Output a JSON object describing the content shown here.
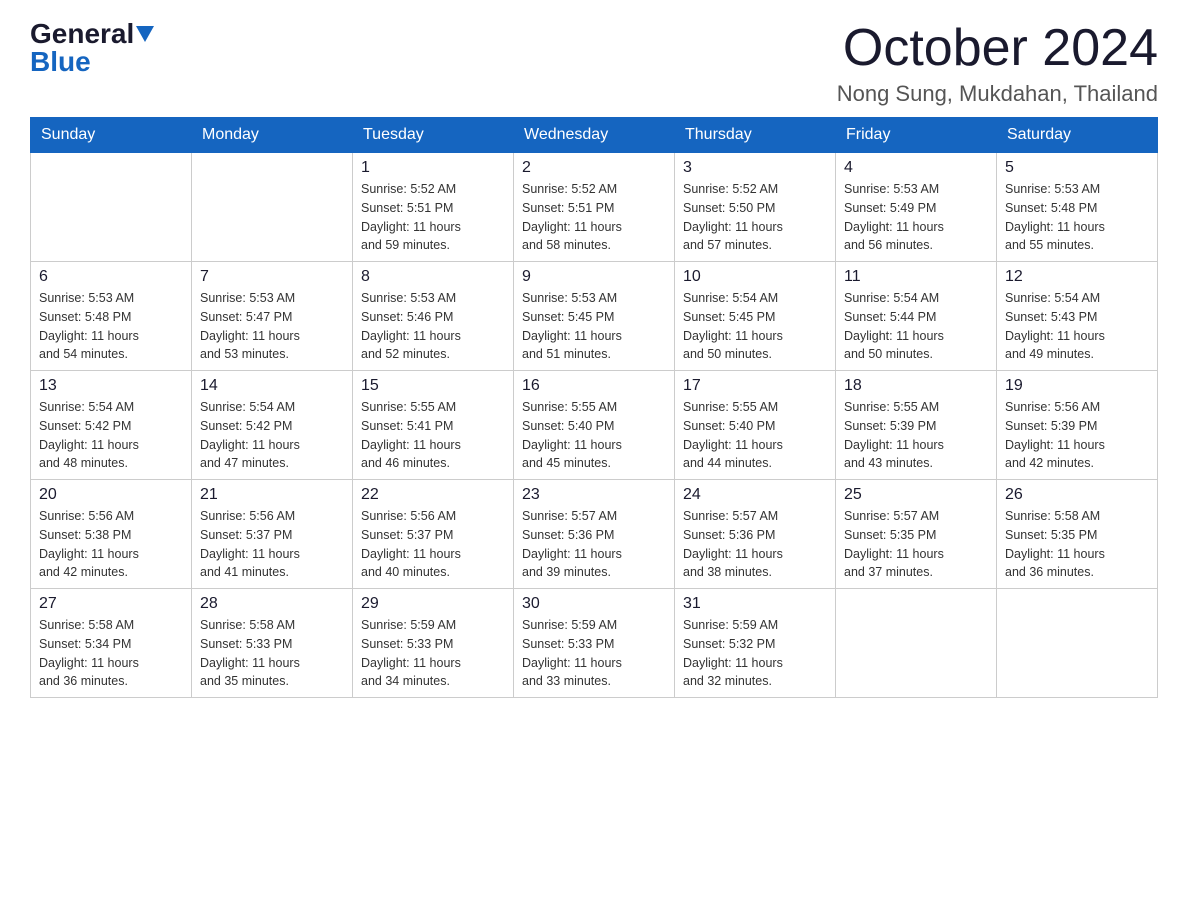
{
  "logo": {
    "general_text": "General",
    "blue_text": "Blue"
  },
  "title": {
    "month_year": "October 2024",
    "location": "Nong Sung, Mukdahan, Thailand"
  },
  "headers": [
    "Sunday",
    "Monday",
    "Tuesday",
    "Wednesday",
    "Thursday",
    "Friday",
    "Saturday"
  ],
  "weeks": [
    [
      {
        "day": "",
        "info": ""
      },
      {
        "day": "",
        "info": ""
      },
      {
        "day": "1",
        "sunrise": "5:52 AM",
        "sunset": "5:51 PM",
        "daylight": "11 hours and 59 minutes."
      },
      {
        "day": "2",
        "sunrise": "5:52 AM",
        "sunset": "5:51 PM",
        "daylight": "11 hours and 58 minutes."
      },
      {
        "day": "3",
        "sunrise": "5:52 AM",
        "sunset": "5:50 PM",
        "daylight": "11 hours and 57 minutes."
      },
      {
        "day": "4",
        "sunrise": "5:53 AM",
        "sunset": "5:49 PM",
        "daylight": "11 hours and 56 minutes."
      },
      {
        "day": "5",
        "sunrise": "5:53 AM",
        "sunset": "5:48 PM",
        "daylight": "11 hours and 55 minutes."
      }
    ],
    [
      {
        "day": "6",
        "sunrise": "5:53 AM",
        "sunset": "5:48 PM",
        "daylight": "11 hours and 54 minutes."
      },
      {
        "day": "7",
        "sunrise": "5:53 AM",
        "sunset": "5:47 PM",
        "daylight": "11 hours and 53 minutes."
      },
      {
        "day": "8",
        "sunrise": "5:53 AM",
        "sunset": "5:46 PM",
        "daylight": "11 hours and 52 minutes."
      },
      {
        "day": "9",
        "sunrise": "5:53 AM",
        "sunset": "5:45 PM",
        "daylight": "11 hours and 51 minutes."
      },
      {
        "day": "10",
        "sunrise": "5:54 AM",
        "sunset": "5:45 PM",
        "daylight": "11 hours and 50 minutes."
      },
      {
        "day": "11",
        "sunrise": "5:54 AM",
        "sunset": "5:44 PM",
        "daylight": "11 hours and 50 minutes."
      },
      {
        "day": "12",
        "sunrise": "5:54 AM",
        "sunset": "5:43 PM",
        "daylight": "11 hours and 49 minutes."
      }
    ],
    [
      {
        "day": "13",
        "sunrise": "5:54 AM",
        "sunset": "5:42 PM",
        "daylight": "11 hours and 48 minutes."
      },
      {
        "day": "14",
        "sunrise": "5:54 AM",
        "sunset": "5:42 PM",
        "daylight": "11 hours and 47 minutes."
      },
      {
        "day": "15",
        "sunrise": "5:55 AM",
        "sunset": "5:41 PM",
        "daylight": "11 hours and 46 minutes."
      },
      {
        "day": "16",
        "sunrise": "5:55 AM",
        "sunset": "5:40 PM",
        "daylight": "11 hours and 45 minutes."
      },
      {
        "day": "17",
        "sunrise": "5:55 AM",
        "sunset": "5:40 PM",
        "daylight": "11 hours and 44 minutes."
      },
      {
        "day": "18",
        "sunrise": "5:55 AM",
        "sunset": "5:39 PM",
        "daylight": "11 hours and 43 minutes."
      },
      {
        "day": "19",
        "sunrise": "5:56 AM",
        "sunset": "5:39 PM",
        "daylight": "11 hours and 42 minutes."
      }
    ],
    [
      {
        "day": "20",
        "sunrise": "5:56 AM",
        "sunset": "5:38 PM",
        "daylight": "11 hours and 42 minutes."
      },
      {
        "day": "21",
        "sunrise": "5:56 AM",
        "sunset": "5:37 PM",
        "daylight": "11 hours and 41 minutes."
      },
      {
        "day": "22",
        "sunrise": "5:56 AM",
        "sunset": "5:37 PM",
        "daylight": "11 hours and 40 minutes."
      },
      {
        "day": "23",
        "sunrise": "5:57 AM",
        "sunset": "5:36 PM",
        "daylight": "11 hours and 39 minutes."
      },
      {
        "day": "24",
        "sunrise": "5:57 AM",
        "sunset": "5:36 PM",
        "daylight": "11 hours and 38 minutes."
      },
      {
        "day": "25",
        "sunrise": "5:57 AM",
        "sunset": "5:35 PM",
        "daylight": "11 hours and 37 minutes."
      },
      {
        "day": "26",
        "sunrise": "5:58 AM",
        "sunset": "5:35 PM",
        "daylight": "11 hours and 36 minutes."
      }
    ],
    [
      {
        "day": "27",
        "sunrise": "5:58 AM",
        "sunset": "5:34 PM",
        "daylight": "11 hours and 36 minutes."
      },
      {
        "day": "28",
        "sunrise": "5:58 AM",
        "sunset": "5:33 PM",
        "daylight": "11 hours and 35 minutes."
      },
      {
        "day": "29",
        "sunrise": "5:59 AM",
        "sunset": "5:33 PM",
        "daylight": "11 hours and 34 minutes."
      },
      {
        "day": "30",
        "sunrise": "5:59 AM",
        "sunset": "5:33 PM",
        "daylight": "11 hours and 33 minutes."
      },
      {
        "day": "31",
        "sunrise": "5:59 AM",
        "sunset": "5:32 PM",
        "daylight": "11 hours and 32 minutes."
      },
      {
        "day": "",
        "info": ""
      },
      {
        "day": "",
        "info": ""
      }
    ]
  ],
  "labels": {
    "sunrise": "Sunrise: ",
    "sunset": "Sunset: ",
    "daylight": "Daylight: "
  }
}
